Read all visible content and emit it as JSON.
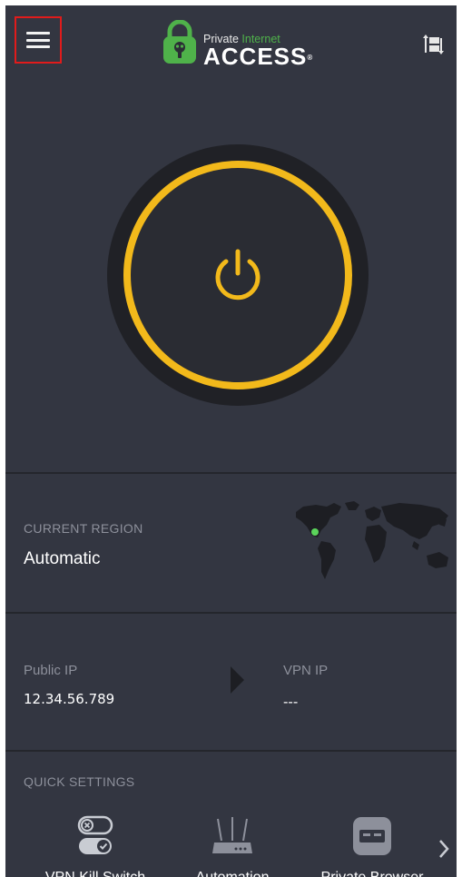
{
  "header": {
    "brand_top_plain": "Private",
    "brand_top_accent": "Internet",
    "brand_main": "ACCESS",
    "brand_mark": "®",
    "menu_icon": "hamburger-menu-icon",
    "switch_icon": "switch-view-icon"
  },
  "connect": {
    "state_icon": "power-icon",
    "accent_color": "#f2b91b"
  },
  "region": {
    "label": "CURRENT REGION",
    "value": "Automatic",
    "marker_color": "#5bd45b"
  },
  "ip": {
    "public_label": "Public IP",
    "public_value": "12.34.56.789",
    "vpn_label": "VPN IP",
    "vpn_value": "---"
  },
  "quick_settings": {
    "label": "QUICK SETTINGS",
    "items": [
      {
        "label": "VPN Kill Switch",
        "icon": "kill-switch-toggle-icon"
      },
      {
        "label": "Automation",
        "icon": "router-icon"
      },
      {
        "label": "Private Browser",
        "icon": "private-browser-icon"
      }
    ],
    "next_icon": "chevron-right-icon"
  },
  "colors": {
    "background": "#333641",
    "divider": "#24262c",
    "brand_green": "#4fb24a"
  }
}
